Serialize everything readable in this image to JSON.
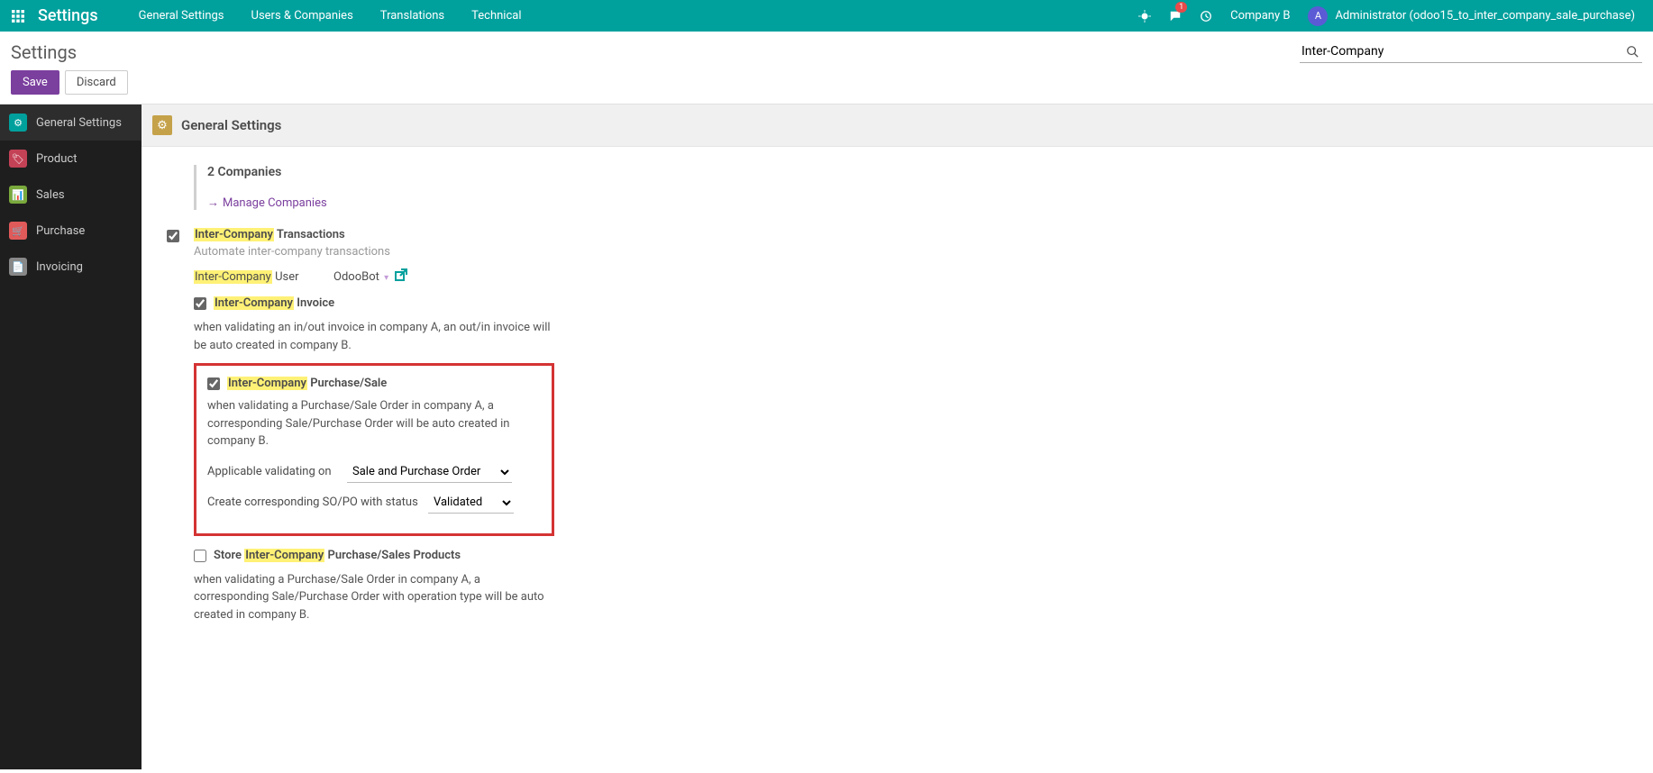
{
  "nav": {
    "app_title": "Settings",
    "items": [
      "General Settings",
      "Users & Companies",
      "Translations",
      "Technical"
    ],
    "msg_badge": "1",
    "company": "Company B",
    "avatar_letter": "A",
    "user_label": "Administrator (odoo15_to_inter_company_sale_purchase)"
  },
  "panel": {
    "breadcrumb": "Settings",
    "search_value": "Inter-Company",
    "save": "Save",
    "discard": "Discard"
  },
  "sidebar": [
    {
      "label": "General Settings",
      "icon": "general",
      "glyph": "⚙"
    },
    {
      "label": "Product",
      "icon": "product",
      "glyph": "🏷"
    },
    {
      "label": "Sales",
      "icon": "sales",
      "glyph": "📊"
    },
    {
      "label": "Purchase",
      "icon": "purchase",
      "glyph": "🛒"
    },
    {
      "label": "Invoicing",
      "icon": "invoicing",
      "glyph": "📄"
    }
  ],
  "section": {
    "header": "General Settings",
    "companies_label": "2 Companies",
    "manage": "Manage Companies"
  },
  "trans": {
    "hi": "Inter-Company",
    "title_rest": " Transactions",
    "desc": "Automate inter-company transactions",
    "user_label_rest": " User",
    "user_value": "OdooBot"
  },
  "invoice": {
    "hi": "Inter-Company",
    "label_rest": " Invoice",
    "help": "when validating an in/out invoice in company A, an out/in invoice will be auto created in company B."
  },
  "ps": {
    "hi": "Inter-Company",
    "label_rest": " Purchase/Sale",
    "help": "when validating a Purchase/Sale Order in company A, a corresponding Sale/Purchase Order will be auto created in company B.",
    "applicable_label": "Applicable validating on",
    "applicable_value": "Sale and Purchase Order",
    "status_label": "Create corresponding SO/PO with status",
    "status_value": "Validated"
  },
  "store": {
    "label_pre": "Store ",
    "hi": "Inter-Company",
    "label_rest": " Purchase/Sales Products",
    "help": "when validating a Purchase/Sale Order in company A, a corresponding Sale/Purchase Order with operation type will be auto created in company B."
  }
}
